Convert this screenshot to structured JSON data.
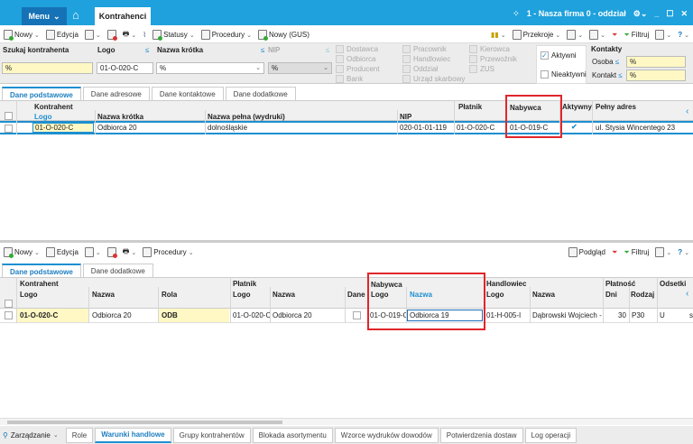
{
  "titlebar": {
    "menu": "Menu",
    "tab": "Kontrahenci",
    "company": "1 - Nasza firma 0 - oddział"
  },
  "toolbar": {
    "nowy": "Nowy",
    "edycja": "Edycja",
    "statusy": "Statusy",
    "procedury": "Procedury",
    "nowy_gus": "Nowy (GUS)",
    "przekroje": "Przekroje",
    "filtruj": "Filtruj"
  },
  "filters": {
    "szukaj_label": "Szukaj kontrahenta",
    "szukaj_value": "%",
    "logo_label": "Logo",
    "logo_value": "01-O-020-C",
    "nazwa_label": "Nazwa krótka",
    "nazwa_value": "%",
    "nip_label": "NIP",
    "nip_value": "%",
    "roles": [
      "Dostawca",
      "Odbiorca",
      "Producent",
      "Bank",
      "Pracownik",
      "Handlowiec",
      "Oddział",
      "Urząd skarbowy",
      "Kierowca",
      "Przewoźnik",
      "ZUS"
    ],
    "aktywni": "Aktywni",
    "nieaktywni": "Nieaktywni",
    "aktywni_checked": true,
    "nieaktywni_checked": false,
    "kontakty": "Kontakty",
    "osoba": "Osoba",
    "osoba_value": "%",
    "kontakt": "Kontakt",
    "kontakt_value": "%"
  },
  "upper": {
    "tabs": [
      "Dane podstawowe",
      "Dane adresowe",
      "Dane kontaktowe",
      "Dane dodatkowe"
    ],
    "headers": {
      "kontrahent": "Kontrahent",
      "logo": "Logo",
      "nazwa_krotka": "Nazwa krótka",
      "nazwa_pelna": "Nazwa pełna (wydruki)",
      "nip": "NIP",
      "platnik": "Płatnik",
      "nabywca": "Nabywca",
      "aktywny": "Aktywny",
      "adres": "Pełny adres"
    },
    "row": {
      "logo": "01-O-020-C",
      "nazwa_krotka": "Odbiorca 20",
      "nazwa_pelna": "dolnośląskie",
      "nip": "020-01-01-119",
      "platnik": "01-O-020-C",
      "nabywca": "01-O-019-C",
      "aktywny": true,
      "adres": "ul. Stysia Wincentego 23"
    }
  },
  "lower_toolbar": {
    "nowy": "Nowy",
    "edycja": "Edycja",
    "procedury": "Procedury",
    "podglad": "Podgląd",
    "filtruj": "Filtruj"
  },
  "lower": {
    "tabs": [
      "Dane podstawowe",
      "Dane dodatkowe"
    ],
    "headers": {
      "kontrahent": "Kontrahent",
      "logo": "Logo",
      "nazwa": "Nazwa",
      "rola": "Rola",
      "platnik": "Płatnik",
      "p_logo": "Logo",
      "p_nazwa": "Nazwa",
      "dane": "Dane",
      "nabywca": "Nabywca",
      "n_logo": "Logo",
      "n_nazwa": "Nazwa",
      "handlowiec": "Handlowiec",
      "h_logo": "Logo",
      "h_nazwa": "Nazwa",
      "platnosc": "Płatność",
      "dni": "Dni",
      "rodzaj": "Rodzaj",
      "odsetki": "Odsetki"
    },
    "row": {
      "logo": "01-O-020-C",
      "nazwa": "Odbiorca 20",
      "rola": "ODB",
      "p_logo": "01-O-020-C",
      "p_nazwa": "Odbiorca 20",
      "n_logo": "01-O-019-C",
      "n_nazwa": "Odbiorca 19",
      "h_logo": "01-H-005-I",
      "h_nazwa": "Dąbrowski Wojciech -",
      "dni": "30",
      "rodzaj": "P30",
      "odsetki": "U",
      "extra": "s"
    }
  },
  "bottom": {
    "zarzadzanie": "Zarządzanie",
    "tabs": [
      "Role",
      "Warunki handlowe",
      "Grupy kontrahentów",
      "Blokada asortymentu",
      "Wzorce wydruków dowodów",
      "Potwierdzenia dostaw",
      "Log operacji"
    ],
    "active": 1
  },
  "colors": {
    "title": "#1ea1dc",
    "menu": "#1572b6",
    "accent": "#1e8fd0",
    "highlight": "#e0262b",
    "yellow": "#fff8c4"
  }
}
